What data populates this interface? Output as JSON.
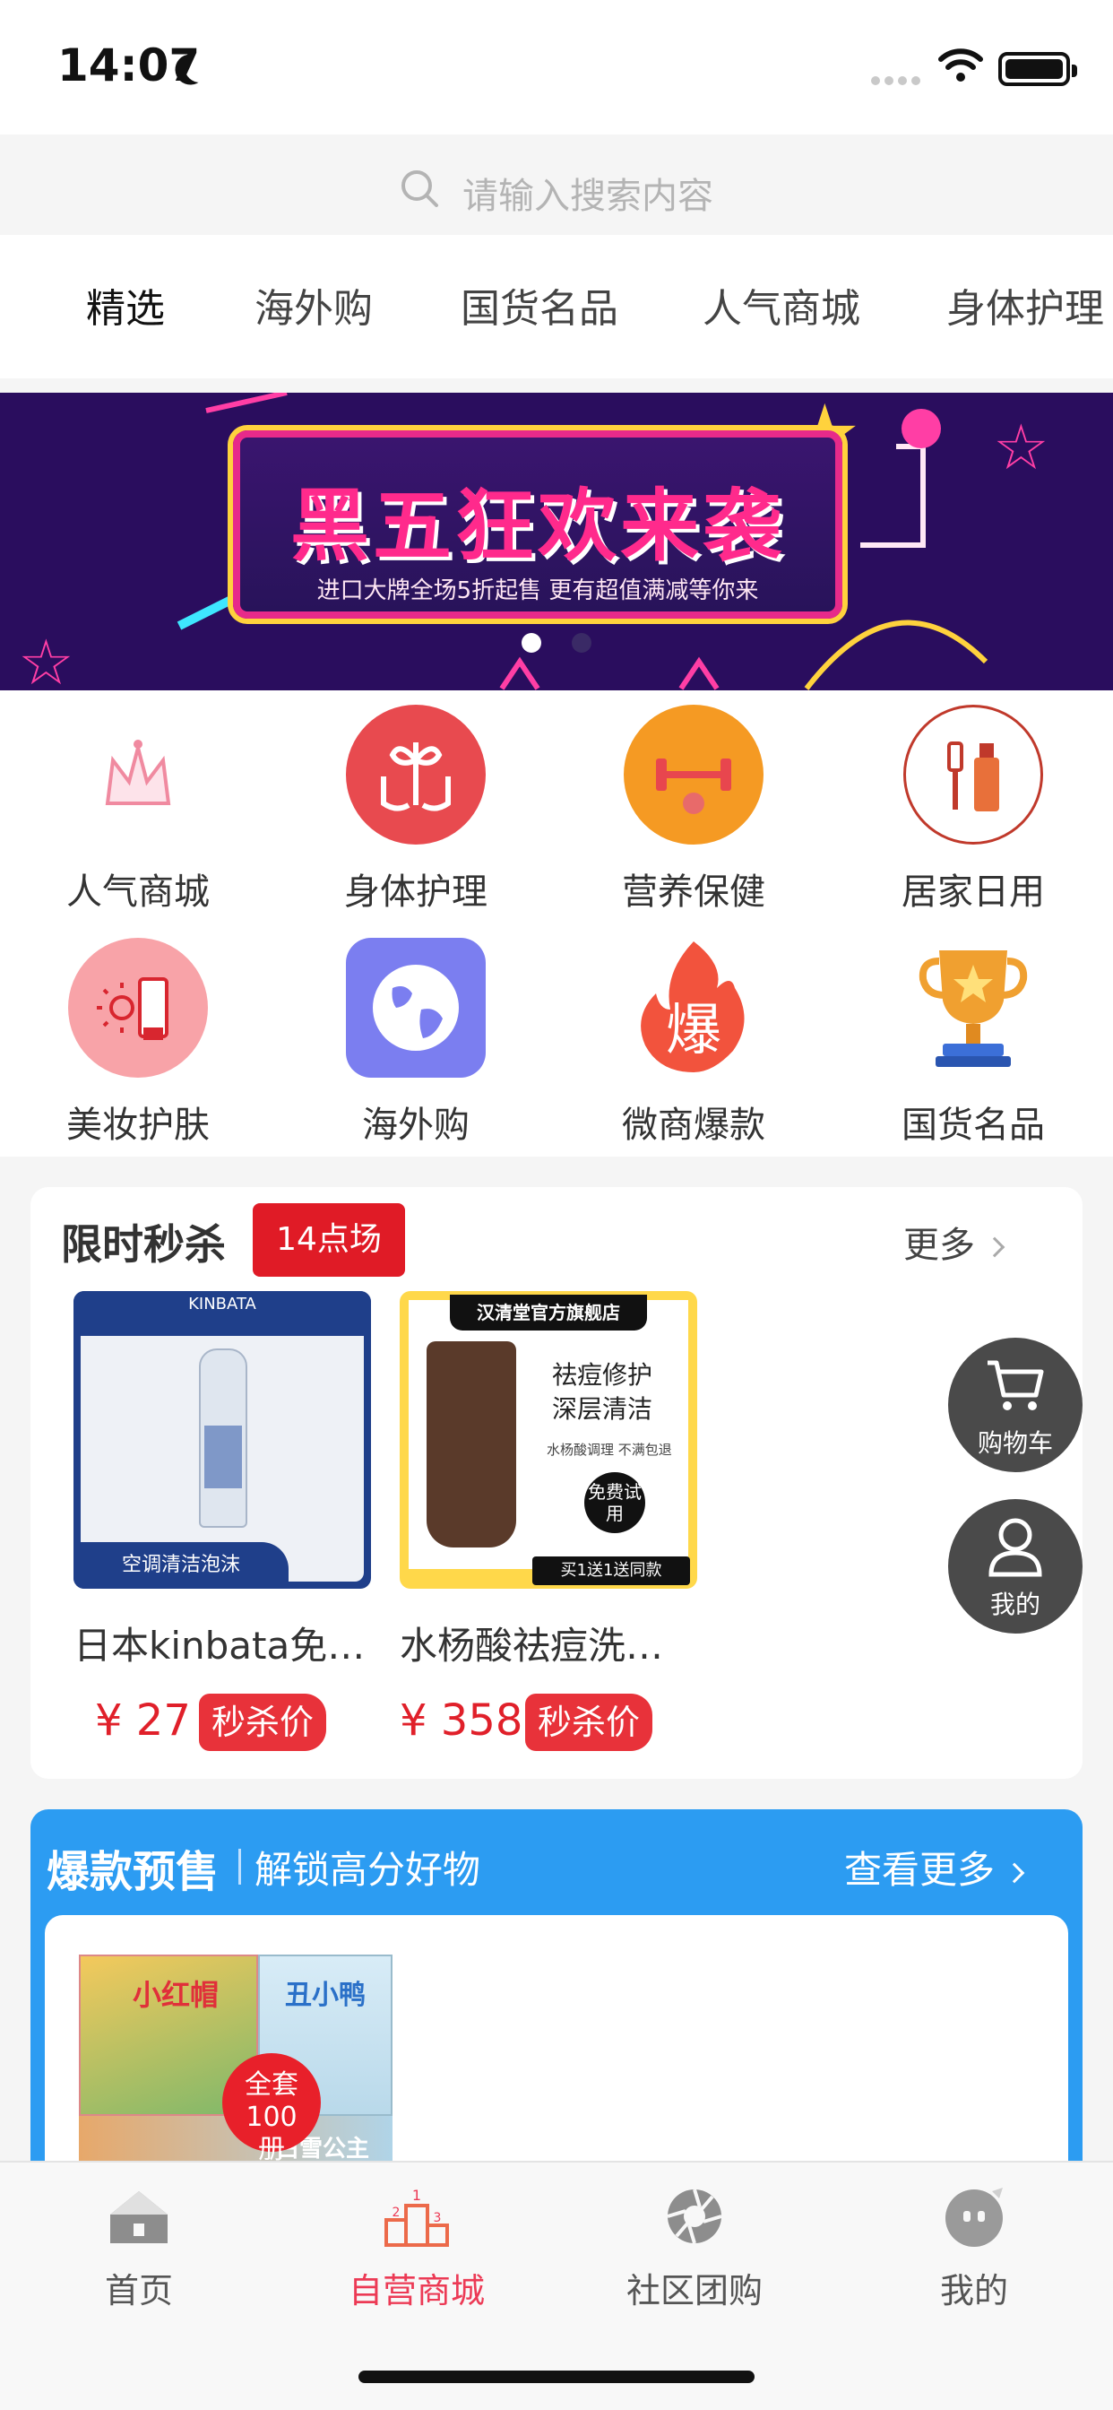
{
  "status_bar": {
    "time": "14:07"
  },
  "search": {
    "placeholder": "请输入搜索内容"
  },
  "top_tabs": [
    "精选",
    "海外购",
    "国货名品",
    "人气商城",
    "身体护理"
  ],
  "banner": {
    "title": "黑五狂欢来袭",
    "subtitle": "进口大牌全场5折起售 更有超值满减等你来",
    "page_count": 2,
    "active_page": 1
  },
  "categories": [
    {
      "label": "人气商城",
      "icon": "crown-icon",
      "color": "#f08aa0"
    },
    {
      "label": "身体护理",
      "icon": "hands-leaf-icon",
      "color": "#e84a4f"
    },
    {
      "label": "营养保健",
      "icon": "dumbbell-icon",
      "color": "#f59a23"
    },
    {
      "label": "居家日用",
      "icon": "toothbrush-icon",
      "color": "#c0392b"
    },
    {
      "label": "美妆护肤",
      "icon": "sunscreen-icon",
      "color": "#f8a3a8"
    },
    {
      "label": "海外购",
      "icon": "globe-icon",
      "color": "#7b7ef0"
    },
    {
      "label": "微商爆款",
      "icon": "fire-icon",
      "color": "#f2533d"
    },
    {
      "label": "国货名品",
      "icon": "trophy-icon",
      "color": "#f0a030"
    }
  ],
  "flash_sale": {
    "title": "限时秒杀",
    "session": "14点场",
    "more": "更多",
    "products": [
      {
        "name": "日本kinbata免洗空调清洁剂",
        "price": "¥ 27",
        "tag": "秒杀价",
        "img_brand": "KINBATA",
        "img_caption": "空调清洁泡沫"
      },
      {
        "name": "水杨酸祛痘洗面奶",
        "price": "¥ 358",
        "tag": "秒杀价",
        "img_brand": "汉清堂官方旗舰店",
        "img_line1": "祛痘修护",
        "img_line2": "深层清洁",
        "img_line3": "水杨酸调理 不满包退",
        "img_badge": "免费试用",
        "img_footer": "买1送1送同款"
      }
    ]
  },
  "floating": {
    "cart": "购物车",
    "mine": "我的"
  },
  "presale": {
    "title": "爆款预售",
    "subtitle": "解锁高分好物",
    "more": "查看更多",
    "book_title1": "小红帽",
    "book_title2": "丑小鸭",
    "book_title3": "白雪公主",
    "book_badge": "全套100册"
  },
  "tab_bar": [
    {
      "label": "首页",
      "icon": "home-icon"
    },
    {
      "label": "自营商城",
      "icon": "podium-icon"
    },
    {
      "label": "社区团购",
      "icon": "aperture-icon"
    },
    {
      "label": "我的",
      "icon": "profile-icon"
    }
  ],
  "colors": {
    "accent_red": "#e01b26",
    "tab_active": "#ec3a55",
    "presale_blue": "#2c9cf2"
  }
}
